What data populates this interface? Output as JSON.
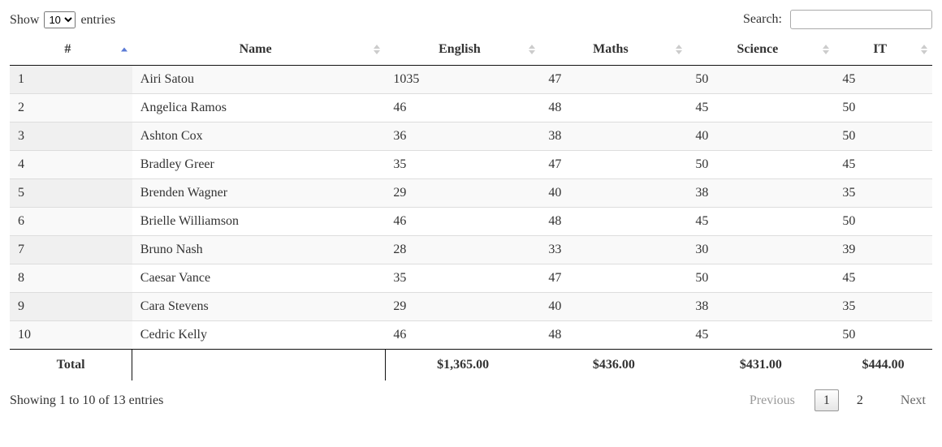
{
  "length": {
    "prefix": "Show",
    "suffix": "entries",
    "value": "10"
  },
  "search": {
    "label": "Search:",
    "value": ""
  },
  "columns": {
    "idx": "#",
    "name": "Name",
    "english": "English",
    "maths": "Maths",
    "science": "Science",
    "it": "IT"
  },
  "rows": [
    {
      "idx": "1",
      "name": "Airi Satou",
      "english": "1035",
      "maths": "47",
      "science": "50",
      "it": "45"
    },
    {
      "idx": "2",
      "name": "Angelica Ramos",
      "english": "46",
      "maths": "48",
      "science": "45",
      "it": "50"
    },
    {
      "idx": "3",
      "name": "Ashton Cox",
      "english": "36",
      "maths": "38",
      "science": "40",
      "it": "50"
    },
    {
      "idx": "4",
      "name": "Bradley Greer",
      "english": "35",
      "maths": "47",
      "science": "50",
      "it": "45"
    },
    {
      "idx": "5",
      "name": "Brenden Wagner",
      "english": "29",
      "maths": "40",
      "science": "38",
      "it": "35"
    },
    {
      "idx": "6",
      "name": "Brielle Williamson",
      "english": "46",
      "maths": "48",
      "science": "45",
      "it": "50"
    },
    {
      "idx": "7",
      "name": "Bruno Nash",
      "english": "28",
      "maths": "33",
      "science": "30",
      "it": "39"
    },
    {
      "idx": "8",
      "name": "Caesar Vance",
      "english": "35",
      "maths": "47",
      "science": "50",
      "it": "45"
    },
    {
      "idx": "9",
      "name": "Cara Stevens",
      "english": "29",
      "maths": "40",
      "science": "38",
      "it": "35"
    },
    {
      "idx": "10",
      "name": "Cedric Kelly",
      "english": "46",
      "maths": "48",
      "science": "45",
      "it": "50"
    }
  ],
  "footer": {
    "label": "Total",
    "english": "$1,365.00",
    "maths": "$436.00",
    "science": "$431.00",
    "it": "$444.00"
  },
  "info": "Showing 1 to 10 of 13 entries",
  "paginate": {
    "prev": "Previous",
    "next": "Next",
    "pages": [
      "1",
      "2"
    ],
    "current": "1"
  }
}
